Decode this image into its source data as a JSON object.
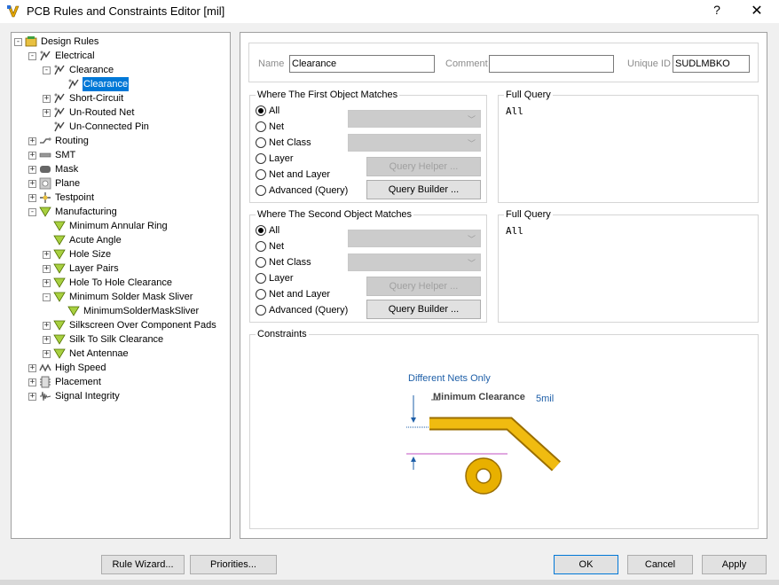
{
  "window": {
    "title": "PCB Rules and Constraints Editor [mil]",
    "help_label": "?",
    "close_label": "✕"
  },
  "tree": {
    "items": [
      {
        "label": "Design Rules",
        "level": 0,
        "expander": "−",
        "icon": "design-rules-icon"
      },
      {
        "label": "Electrical",
        "level": 1,
        "expander": "−",
        "icon": "electrical-icon"
      },
      {
        "label": "Clearance",
        "level": 2,
        "expander": "−",
        "icon": "clearance-icon"
      },
      {
        "label": "Clearance",
        "level": 3,
        "expander": "",
        "icon": "clearance-rule-icon",
        "selected": true
      },
      {
        "label": "Short-Circuit",
        "level": 2,
        "expander": "+",
        "icon": "short-circuit-icon"
      },
      {
        "label": "Un-Routed Net",
        "level": 2,
        "expander": "+",
        "icon": "unrouted-net-icon"
      },
      {
        "label": "Un-Connected Pin",
        "level": 2,
        "expander": "",
        "icon": "unconnected-pin-icon"
      },
      {
        "label": "Routing",
        "level": 1,
        "expander": "+",
        "icon": "routing-icon"
      },
      {
        "label": "SMT",
        "level": 1,
        "expander": "+",
        "icon": "smt-icon"
      },
      {
        "label": "Mask",
        "level": 1,
        "expander": "+",
        "icon": "mask-icon"
      },
      {
        "label": "Plane",
        "level": 1,
        "expander": "+",
        "icon": "plane-icon"
      },
      {
        "label": "Testpoint",
        "level": 1,
        "expander": "+",
        "icon": "testpoint-icon"
      },
      {
        "label": "Manufacturing",
        "level": 1,
        "expander": "−",
        "icon": "manufacturing-icon"
      },
      {
        "label": "Minimum Annular Ring",
        "level": 2,
        "expander": "",
        "icon": "manufacturing-rule-icon"
      },
      {
        "label": "Acute Angle",
        "level": 2,
        "expander": "",
        "icon": "manufacturing-rule-icon"
      },
      {
        "label": "Hole Size",
        "level": 2,
        "expander": "+",
        "icon": "manufacturing-rule-icon"
      },
      {
        "label": "Layer Pairs",
        "level": 2,
        "expander": "+",
        "icon": "manufacturing-rule-icon"
      },
      {
        "label": "Hole To Hole Clearance",
        "level": 2,
        "expander": "+",
        "icon": "manufacturing-rule-icon"
      },
      {
        "label": "Minimum Solder Mask Sliver",
        "level": 2,
        "expander": "−",
        "icon": "manufacturing-rule-icon"
      },
      {
        "label": "MinimumSolderMaskSliver",
        "level": 3,
        "expander": "",
        "icon": "manufacturing-rule-icon"
      },
      {
        "label": "Silkscreen Over Component Pads",
        "level": 2,
        "expander": "+",
        "icon": "manufacturing-rule-icon"
      },
      {
        "label": "Silk To Silk Clearance",
        "level": 2,
        "expander": "+",
        "icon": "manufacturing-rule-icon"
      },
      {
        "label": "Net Antennae",
        "level": 2,
        "expander": "+",
        "icon": "manufacturing-rule-icon"
      },
      {
        "label": "High Speed",
        "level": 1,
        "expander": "+",
        "icon": "high-speed-icon"
      },
      {
        "label": "Placement",
        "level": 1,
        "expander": "+",
        "icon": "placement-icon"
      },
      {
        "label": "Signal Integrity",
        "level": 1,
        "expander": "+",
        "icon": "signal-integrity-icon"
      }
    ]
  },
  "rule": {
    "name_label": "Name",
    "name_value": "Clearance",
    "comment_label": "Comment",
    "comment_value": "",
    "uid_label": "Unique ID",
    "uid_value": "SUDLMBKO"
  },
  "first_match": {
    "title": "Where The First Object Matches",
    "options": [
      "All",
      "Net",
      "Net Class",
      "Layer",
      "Net and Layer",
      "Advanced (Query)"
    ],
    "selected": "All",
    "query_helper": "Query Helper ...",
    "query_builder": "Query Builder ...",
    "full_query_title": "Full Query",
    "full_query": "All"
  },
  "second_match": {
    "title": "Where The Second Object Matches",
    "options": [
      "All",
      "Net",
      "Net Class",
      "Layer",
      "Net and Layer",
      "Advanced (Query)"
    ],
    "selected": "All",
    "query_helper": "Query Helper ...",
    "query_builder": "Query Builder ...",
    "full_query_title": "Full Query",
    "full_query": "All"
  },
  "constraints": {
    "title": "Constraints",
    "different_nets": "Different Nets Only",
    "min_clearance_label": "Minimum Clearance",
    "min_clearance_value": "5mil",
    "colors": {
      "copper": "#e8b000",
      "blue": "#1e5fa8"
    }
  },
  "footer": {
    "rule_wizard": "Rule Wizard...",
    "priorities": "Priorities...",
    "ok": "OK",
    "cancel": "Cancel",
    "apply": "Apply"
  }
}
